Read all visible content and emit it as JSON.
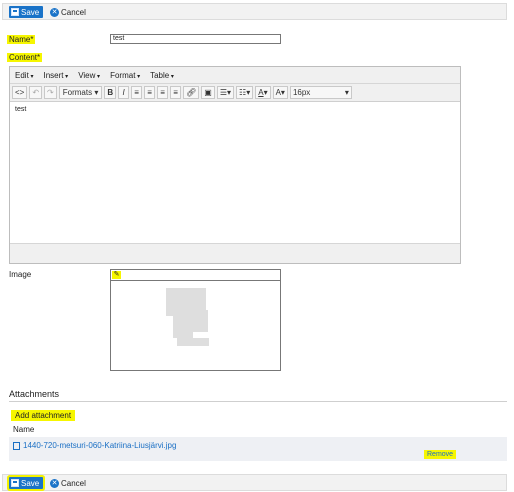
{
  "toolbar": {
    "save_label": "Save",
    "cancel_label": "Cancel"
  },
  "fields": {
    "name_label": "Name*",
    "name_value": "test",
    "content_label": "Content*",
    "image_label": "Image"
  },
  "editor": {
    "menus": [
      "Edit",
      "Insert",
      "View",
      "Format",
      "Table"
    ],
    "formats_label": "Formats",
    "font_size": "16px",
    "content": "test"
  },
  "attachments": {
    "title": "Attachments",
    "add_label": "Add attachment",
    "name_header": "Name",
    "files": [
      {
        "name": "1440-720-metsuri-060-Katriina-Liusjärvi.jpg",
        "remove_label": "Remove"
      }
    ]
  },
  "colors": {
    "highlight": "#f6f600",
    "primary": "#1a73c8",
    "link": "#1a6fc4"
  }
}
